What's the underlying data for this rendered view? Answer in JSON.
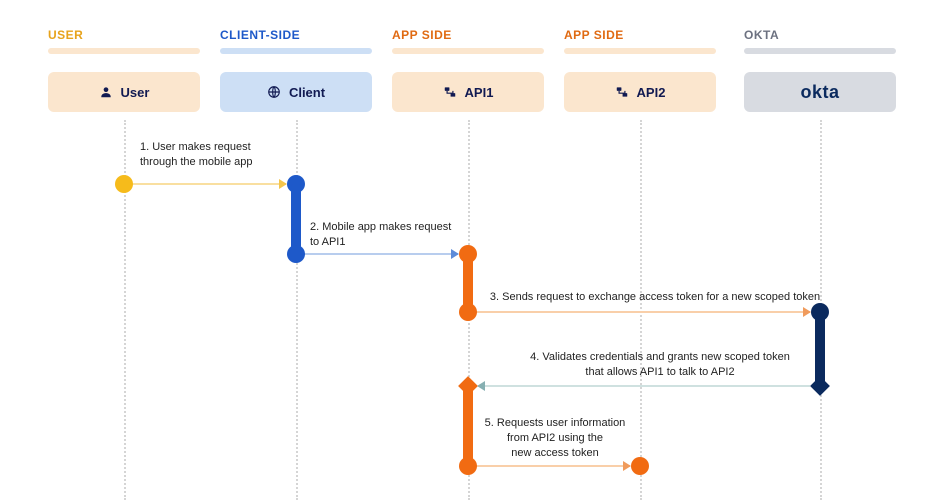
{
  "columns": {
    "user": {
      "label": "USER",
      "box": "User"
    },
    "client": {
      "label": "CLIENT-SIDE",
      "box": "Client"
    },
    "api1": {
      "label": "APP SIDE",
      "box": "API1"
    },
    "api2": {
      "label": "APP SIDE",
      "box": "API2"
    },
    "okta": {
      "label": "OKTA",
      "box": "okta"
    }
  },
  "steps": {
    "s1": "1. User makes request\nthrough the mobile app",
    "s2": "2. Mobile app makes request\nto API1",
    "s3": "3. Sends request to exchange access token for a new scoped token",
    "s4": "4. Validates credentials and grants new scoped token\nthat allows API1 to talk to API2",
    "s5": "5. Requests user information\nfrom API2 using the\nnew access token"
  },
  "colors": {
    "yellow": "#f6bb1b",
    "blue": "#1e59c9",
    "orange": "#f16b12",
    "navy": "#0b2a5e"
  }
}
